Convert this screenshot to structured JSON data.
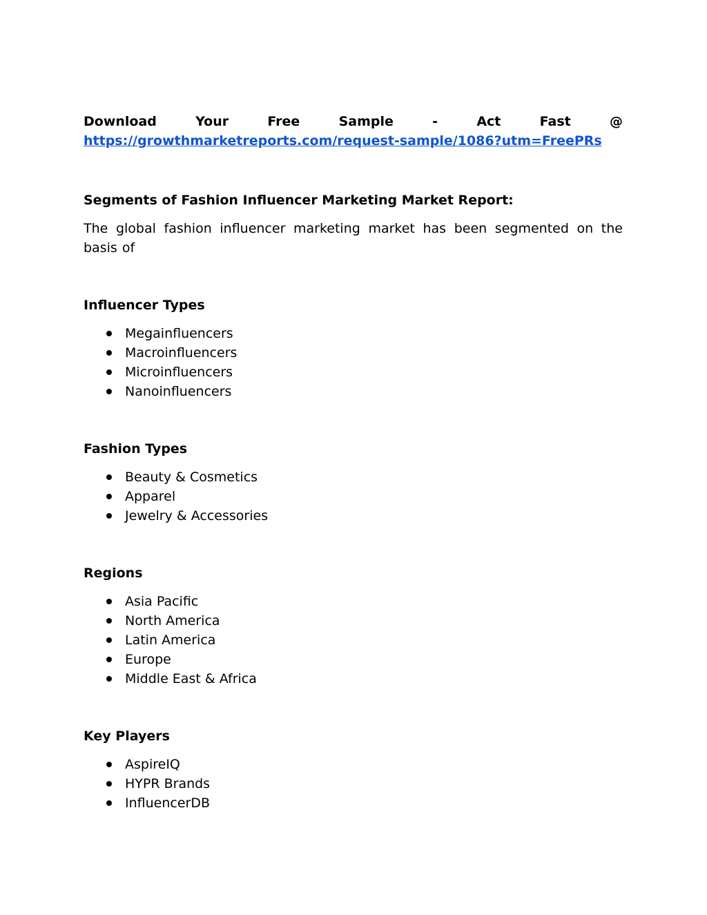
{
  "cta": {
    "words": [
      "Download",
      "Your",
      "Free",
      "Sample",
      "-",
      "Act",
      "Fast",
      "@"
    ],
    "link_text": "https://growthmarketreports.com/request-sample/1086?utm=FreePRs",
    "link_color": "#1155cc"
  },
  "intro": {
    "heading": "Segments of Fashion Influencer Marketing Market Report:",
    "paragraph": "The global fashion influencer marketing market has been segmented on the basis of"
  },
  "segments": [
    {
      "title": "Influencer Types",
      "items": [
        "Megainfluencers",
        "Macroinfluencers",
        "Microinfluencers",
        "Nanoinfluencers"
      ]
    },
    {
      "title": "Fashion Types",
      "items": [
        "Beauty & Cosmetics",
        "Apparel",
        "Jewelry & Accessories"
      ]
    },
    {
      "title": "Regions",
      "items": [
        "Asia Pacific",
        "North America",
        "Latin America",
        "Europe",
        "Middle East & Africa"
      ]
    },
    {
      "title": "Key Players",
      "items": [
        "AspireIQ",
        "HYPR Brands",
        "InfluencerDB"
      ]
    }
  ]
}
